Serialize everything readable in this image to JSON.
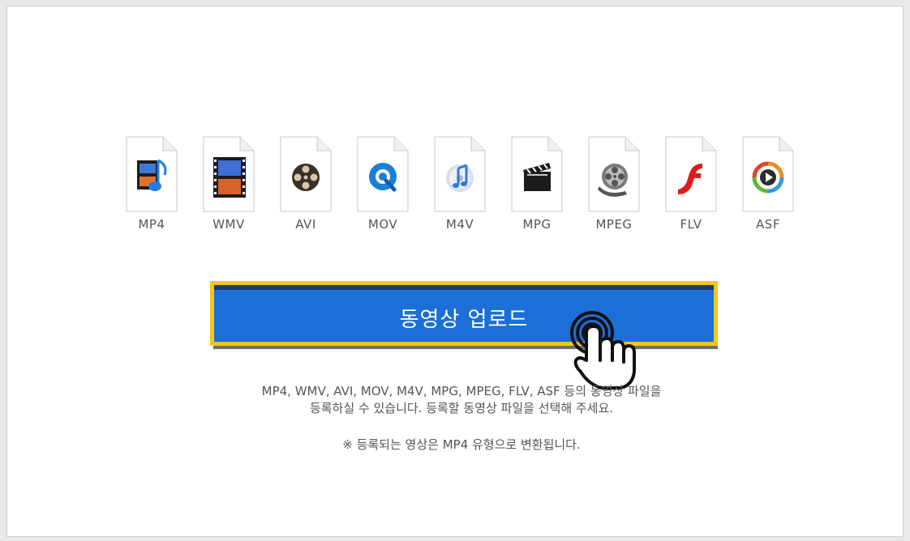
{
  "formats": [
    {
      "label": "MP4",
      "icon": "mp4-film-music-icon"
    },
    {
      "label": "WMV",
      "icon": "wmv-film-strip-icon"
    },
    {
      "label": "AVI",
      "icon": "avi-film-reel-icon"
    },
    {
      "label": "MOV",
      "icon": "quicktime-icon"
    },
    {
      "label": "M4V",
      "icon": "itunes-disc-icon"
    },
    {
      "label": "MPG",
      "icon": "clapperboard-icon"
    },
    {
      "label": "MPEG",
      "icon": "film-reel-icon"
    },
    {
      "label": "FLV",
      "icon": "flash-icon"
    },
    {
      "label": "ASF",
      "icon": "windows-media-play-icon"
    }
  ],
  "upload": {
    "label": "동영상 업로드"
  },
  "description": {
    "line1": "MP4, WMV, AVI, MOV, M4V, MPG, MPEG, FLV, ASF 등의 동영상 파일을",
    "line2": "등록하실 수 있습니다. 등록할 동영상 파일을 선택해 주세요.",
    "note": "※ 등록되는 영상은 MP4 유형으로 변환됩니다."
  },
  "colors": {
    "button_bg": "#1c6fd6",
    "button_border": "#f5c518",
    "text": "#555555"
  }
}
